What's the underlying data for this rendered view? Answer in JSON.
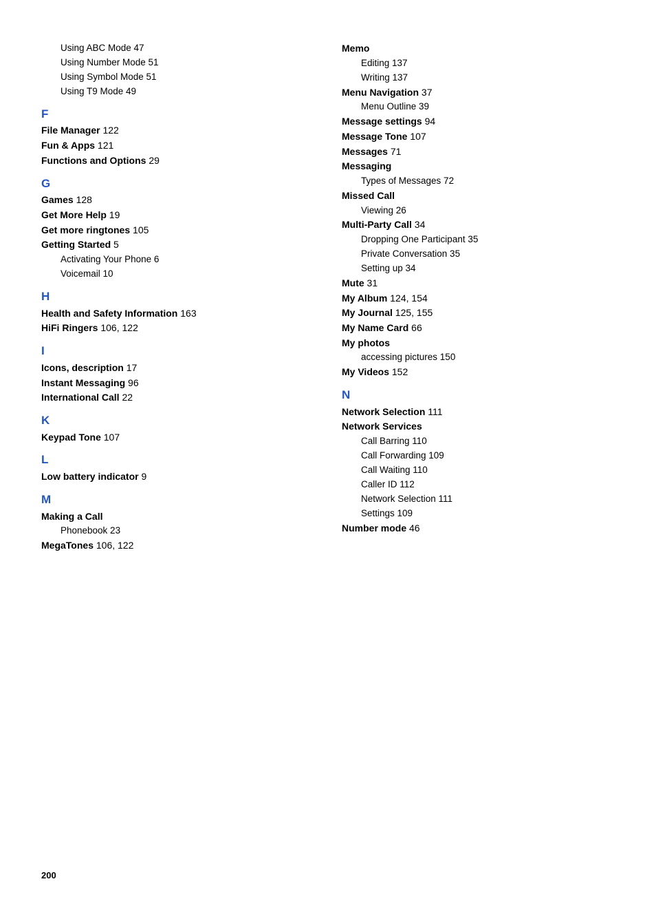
{
  "page": {
    "number": "200",
    "columns": {
      "left": {
        "sections": [
          {
            "type": "entries",
            "items": [
              {
                "type": "sub",
                "text": "Using ABC Mode",
                "page": "47"
              },
              {
                "type": "sub",
                "text": "Using Number Mode",
                "page": "51"
              },
              {
                "type": "sub",
                "text": "Using Symbol Mode",
                "page": "51"
              },
              {
                "type": "sub",
                "text": "Using T9 Mode",
                "page": "49"
              }
            ]
          },
          {
            "type": "letter",
            "letter": "F"
          },
          {
            "type": "entries",
            "items": [
              {
                "type": "main",
                "text": "File Manager",
                "page": "122"
              },
              {
                "type": "main",
                "text": "Fun & Apps",
                "page": "121"
              },
              {
                "type": "main",
                "text": "Functions and Options",
                "page": "29"
              }
            ]
          },
          {
            "type": "letter",
            "letter": "G"
          },
          {
            "type": "entries",
            "items": [
              {
                "type": "main",
                "text": "Games",
                "page": "128"
              },
              {
                "type": "main",
                "text": "Get More Help",
                "page": "19"
              },
              {
                "type": "main",
                "text": "Get more ringtones",
                "page": "105"
              },
              {
                "type": "main",
                "text": "Getting Started",
                "page": "5"
              },
              {
                "type": "sub",
                "text": "Activating Your Phone",
                "page": "6"
              },
              {
                "type": "sub",
                "text": "Voicemail",
                "page": "10"
              }
            ]
          },
          {
            "type": "letter",
            "letter": "H"
          },
          {
            "type": "entries",
            "items": [
              {
                "type": "main",
                "text": "Health and Safety Information",
                "page": "163",
                "multiline": true
              },
              {
                "type": "main",
                "text": "HiFi Ringers",
                "page": "106, 122"
              }
            ]
          },
          {
            "type": "letter",
            "letter": "I"
          },
          {
            "type": "entries",
            "items": [
              {
                "type": "main",
                "text": "Icons, description",
                "page": "17"
              },
              {
                "type": "main",
                "text": "Instant Messaging",
                "page": "96"
              },
              {
                "type": "main",
                "text": "International Call",
                "page": "22"
              }
            ]
          },
          {
            "type": "letter",
            "letter": "K"
          },
          {
            "type": "entries",
            "items": [
              {
                "type": "main",
                "text": "Keypad Tone",
                "page": "107"
              }
            ]
          },
          {
            "type": "letter",
            "letter": "L"
          },
          {
            "type": "entries",
            "items": [
              {
                "type": "main",
                "text": "Low battery indicator",
                "page": "9"
              }
            ]
          },
          {
            "type": "letter",
            "letter": "M"
          },
          {
            "type": "entries",
            "items": [
              {
                "type": "main",
                "text": "Making a Call",
                "page": ""
              },
              {
                "type": "sub",
                "text": "Phonebook",
                "page": "23"
              },
              {
                "type": "main",
                "text": "MegaTones",
                "page": "106, 122"
              }
            ]
          }
        ]
      },
      "right": {
        "sections": [
          {
            "type": "entries",
            "items": [
              {
                "type": "main",
                "text": "Memo",
                "page": ""
              },
              {
                "type": "sub",
                "text": "Editing",
                "page": "137"
              },
              {
                "type": "sub",
                "text": "Writing",
                "page": "137"
              },
              {
                "type": "main",
                "text": "Menu Navigation",
                "page": "37"
              },
              {
                "type": "sub",
                "text": "Menu Outline",
                "page": "39"
              },
              {
                "type": "main",
                "text": "Message settings",
                "page": "94"
              },
              {
                "type": "main",
                "text": "Message Tone",
                "page": "107"
              },
              {
                "type": "main",
                "text": "Messages",
                "page": "71"
              },
              {
                "type": "main",
                "text": "Messaging",
                "page": ""
              },
              {
                "type": "sub",
                "text": "Types of Messages",
                "page": "72"
              },
              {
                "type": "main",
                "text": "Missed Call",
                "page": ""
              },
              {
                "type": "sub",
                "text": "Viewing",
                "page": "26"
              },
              {
                "type": "main",
                "text": "Multi-Party Call",
                "page": "34"
              },
              {
                "type": "sub",
                "text": "Dropping One Participant",
                "page": "35"
              },
              {
                "type": "sub",
                "text": "Private Conversation",
                "page": "35"
              },
              {
                "type": "sub",
                "text": "Setting up",
                "page": "34"
              },
              {
                "type": "main",
                "text": "Mute",
                "page": "31"
              },
              {
                "type": "main",
                "text": "My Album",
                "page": "124, 154"
              },
              {
                "type": "main",
                "text": "My Journal",
                "page": "125, 155"
              },
              {
                "type": "main",
                "text": "My Name Card",
                "page": "66"
              },
              {
                "type": "main",
                "text": "My photos",
                "page": ""
              },
              {
                "type": "sub",
                "text": "accessing pictures",
                "page": "150"
              },
              {
                "type": "main",
                "text": "My Videos",
                "page": "152"
              }
            ]
          },
          {
            "type": "letter",
            "letter": "N"
          },
          {
            "type": "entries",
            "items": [
              {
                "type": "main",
                "text": "Network Selection",
                "page": "111"
              },
              {
                "type": "main",
                "text": "Network Services",
                "page": ""
              },
              {
                "type": "sub",
                "text": "Call Barring",
                "page": "110"
              },
              {
                "type": "sub",
                "text": "Call Forwarding",
                "page": "109"
              },
              {
                "type": "sub",
                "text": "Call Waiting",
                "page": "110"
              },
              {
                "type": "sub",
                "text": "Caller ID",
                "page": "112"
              },
              {
                "type": "sub",
                "text": "Network Selection",
                "page": "111"
              },
              {
                "type": "sub",
                "text": "Settings",
                "page": "109"
              },
              {
                "type": "main",
                "text": "Number mode",
                "page": "46"
              }
            ]
          }
        ]
      }
    }
  }
}
